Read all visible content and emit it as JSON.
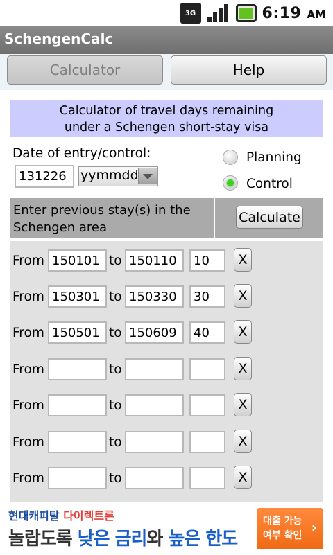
{
  "status_bar": {
    "network": "3G",
    "time": "6:19",
    "ampm": "AM"
  },
  "app": {
    "title": "SchengenCalc"
  },
  "tabs": [
    {
      "label": "Calculator",
      "selected": true
    },
    {
      "label": "Help",
      "selected": false
    }
  ],
  "banner": {
    "line1": "Calculator of travel days remaining",
    "line2": "under a Schengen short-stay visa"
  },
  "entry": {
    "label": "Date of entry/control:",
    "value": "131226",
    "format": "yymmdd"
  },
  "modes": [
    {
      "label": "Planning",
      "checked": false
    },
    {
      "label": "Control",
      "checked": true
    }
  ],
  "stays": {
    "header_line1": "Enter previous stay(s) in the",
    "header_line2": "Schengen area",
    "calculate_label": "Calculate",
    "from_label": "From",
    "to_label": "to",
    "remove_label": "X",
    "rows": [
      {
        "from": "150101",
        "to": "150110",
        "days": "10"
      },
      {
        "from": "150301",
        "to": "150330",
        "days": "30"
      },
      {
        "from": "150501",
        "to": "150609",
        "days": "40"
      },
      {
        "from": "",
        "to": "",
        "days": ""
      },
      {
        "from": "",
        "to": "",
        "days": ""
      },
      {
        "from": "",
        "to": "",
        "days": ""
      },
      {
        "from": "",
        "to": "",
        "days": ""
      }
    ]
  },
  "ad": {
    "brand_a": "현대캐피탈",
    "brand_b": "다이렉트론",
    "headline_1": "놀랍도록",
    "headline_2": "낮은 금리",
    "headline_3": "와",
    "headline_4": "높은 한도",
    "cta_line1": "대출 가능",
    "cta_line2": "여부 확인",
    "cta_chevron": "›"
  },
  "colors": {
    "banner_bg": "#ccccff",
    "radio_on": "#3ad11f",
    "header_bg": "#aaaaaa"
  }
}
